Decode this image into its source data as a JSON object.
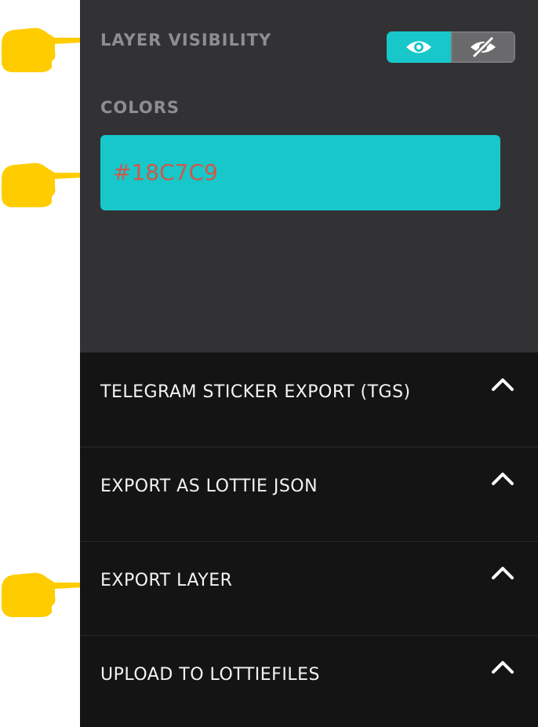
{
  "layer": {
    "visibility_label": "LAYER VISIBILITY",
    "visibility_state": "visible",
    "colors_label": "COLORS",
    "color_value": "#18C7C9"
  },
  "icons": {
    "visible": "eye-icon",
    "hidden": "eye-slash-icon",
    "expand": "chevron-up-icon",
    "annotation": "pointing-hand-icon"
  },
  "export_sections": [
    {
      "label": "TELEGRAM STICKER EXPORT (TGS)"
    },
    {
      "label": "EXPORT AS LOTTIE JSON"
    },
    {
      "label": "EXPORT LAYER"
    },
    {
      "label": "UPLOAD TO LOTTIEFILES"
    }
  ],
  "colors": {
    "accent": "#18C7C9",
    "panel_bg": "#141414",
    "section_bg": "#323234",
    "pointer": "#FFCC00",
    "color_text": "#d0584a"
  }
}
